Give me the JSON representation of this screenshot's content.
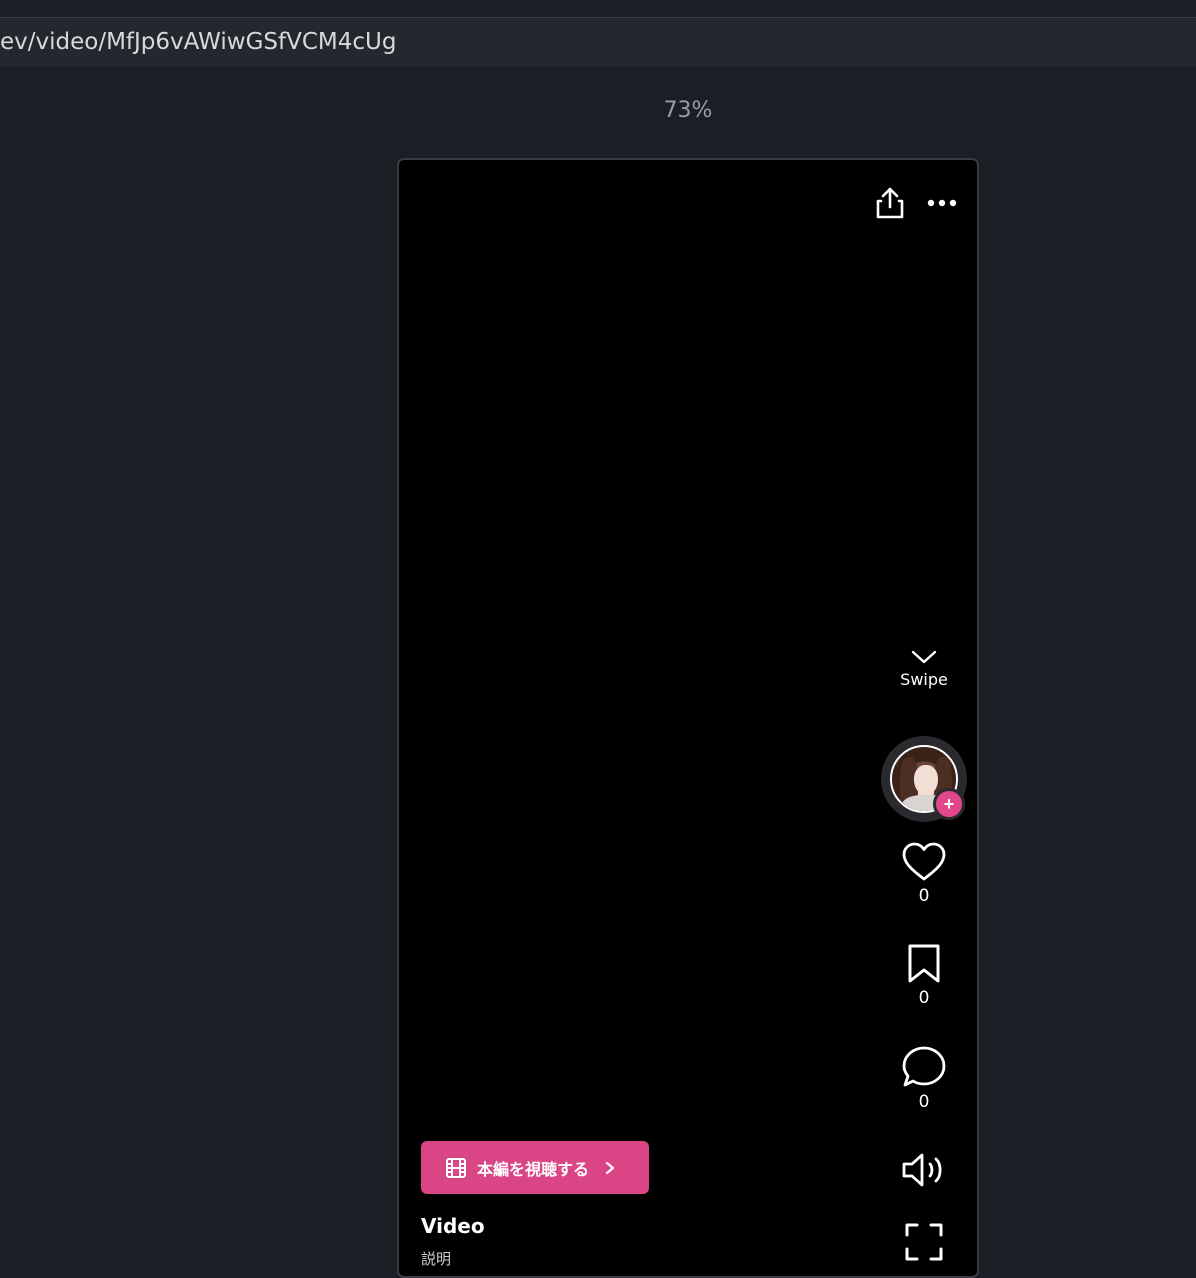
{
  "browser": {
    "url": "ev/video/MfJp6vAWiwGSfVCM4cUg"
  },
  "zoom": "73%",
  "player": {
    "share_icon": "share-icon",
    "more_icon": "more-icon",
    "swipe_label": "Swipe",
    "likes": "0",
    "bookmarks": "0",
    "comments": "0",
    "follow_symbol": "+",
    "watch_button_label": "本編を視聴する",
    "title": "Video",
    "description": "説明"
  },
  "colors": {
    "accent": "#d94585",
    "background": "#1c1e25",
    "player_bg": "#000000"
  }
}
